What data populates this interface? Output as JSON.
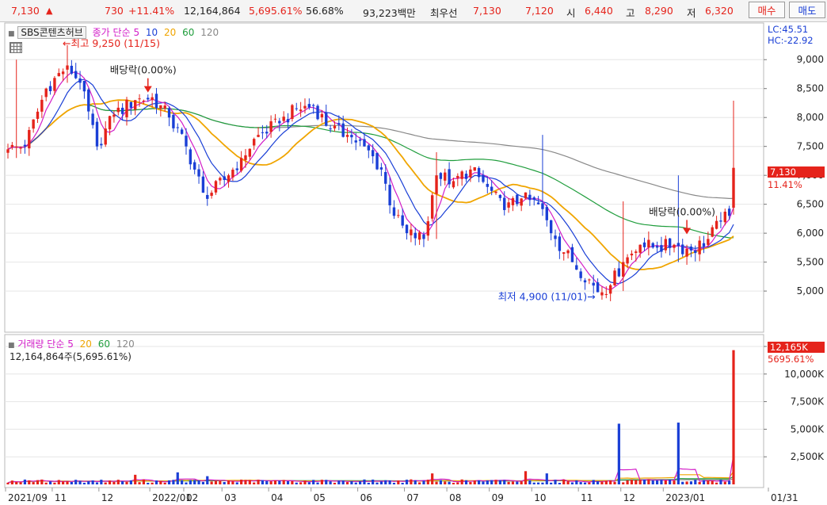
{
  "quote_bar": {
    "price": "7,130",
    "up_arrow": "▲",
    "change": "730",
    "change_pct": "+11.41%",
    "volume": "12,164,864",
    "volume_ratio": "5,695.61%",
    "turnover": "56.68%",
    "amount": "93,223백만",
    "best_ask_label": "최우선",
    "best_ask": "7,130",
    "best_bid": "7,120",
    "open_label": "시",
    "open": "6,440",
    "high_label": "고",
    "high": "8,290",
    "low_label": "저",
    "low": "6,320",
    "buy_label": "매수",
    "sell_label": "매도"
  },
  "price_panel": {
    "stock_name": "SBS콘텐츠허브",
    "legend_title": "종가 단순",
    "ma_periods": [
      "5",
      "10",
      "20",
      "60",
      "120"
    ],
    "lc": "LC:45.51",
    "hc": "HC:-22.92",
    "current_price_label": "7,130",
    "current_change_label": "11.41%"
  },
  "volume_panel": {
    "legend_title": "거래량 단순",
    "ma_periods": [
      "5",
      "20",
      "60",
      "120"
    ],
    "summary": "12,164,864주(5,695.61%)",
    "current_volume_label": "12,165K",
    "current_ratio_label": "5695.61%"
  },
  "chart_data": {
    "type": "candlestick",
    "x_tick_labels": [
      "2021/09",
      "11",
      "12",
      "2022/01",
      "02",
      "03",
      "04",
      "05",
      "06",
      "07",
      "08",
      "09",
      "10",
      "11",
      "12",
      "2023/01",
      "01/31"
    ],
    "price_axis": {
      "ylim": [
        4700,
        9250
      ],
      "ticks": [
        5000,
        5500,
        6000,
        6500,
        7000,
        7500,
        8000,
        8500,
        9000
      ]
    },
    "volume_axis": {
      "ylim": [
        0,
        12500
      ],
      "ticks": [
        2500,
        5000,
        7500,
        10000,
        12500
      ],
      "unit": "K"
    },
    "series_colors": {
      "up": "#e5231b",
      "down": "#1a3fd6",
      "ma5": "#d21dc8",
      "ma10": "#1a3fd6",
      "ma20": "#f0a500",
      "ma60": "#1f9d3c",
      "ma120": "#888888"
    },
    "close_anchors": [
      [
        0,
        7450
      ],
      [
        4,
        7500
      ],
      [
        9,
        8500
      ],
      [
        14,
        8900
      ],
      [
        17,
        8600
      ],
      [
        21,
        7500
      ],
      [
        25,
        8050
      ],
      [
        30,
        8300
      ],
      [
        34,
        8350
      ],
      [
        38,
        8000
      ],
      [
        42,
        7500
      ],
      [
        46,
        6700
      ],
      [
        48,
        6700
      ],
      [
        52,
        7000
      ],
      [
        55,
        7300
      ],
      [
        59,
        7700
      ],
      [
        64,
        7900
      ],
      [
        68,
        8150
      ],
      [
        72,
        8200
      ],
      [
        76,
        7800
      ],
      [
        80,
        7700
      ],
      [
        84,
        7500
      ],
      [
        88,
        7100
      ],
      [
        91,
        6300
      ],
      [
        94,
        6000
      ],
      [
        98,
        5900
      ],
      [
        101,
        7000
      ],
      [
        105,
        6900
      ],
      [
        109,
        7100
      ],
      [
        113,
        6800
      ],
      [
        117,
        6400
      ],
      [
        121,
        6600
      ],
      [
        125,
        6500
      ],
      [
        129,
        5900
      ],
      [
        133,
        5500
      ],
      [
        137,
        5200
      ],
      [
        139,
        4980
      ],
      [
        142,
        5100
      ],
      [
        145,
        5500
      ],
      [
        149,
        5800
      ],
      [
        153,
        5750
      ],
      [
        157,
        5800
      ],
      [
        161,
        5700
      ],
      [
        165,
        5900
      ],
      [
        168,
        6200
      ],
      [
        170,
        6300
      ],
      [
        171,
        7130
      ]
    ],
    "special_bars": [
      {
        "index": 2,
        "high": 9000,
        "low": 7300
      },
      {
        "index": 14,
        "high": 9250,
        "low": 8600
      },
      {
        "index": 101,
        "high": 7400,
        "low": 5900
      },
      {
        "index": 126,
        "high": 7700,
        "low": 6300
      },
      {
        "index": 145,
        "high": 6550,
        "low": 5000
      },
      {
        "index": 158,
        "high": 7000,
        "low": 5500
      },
      {
        "index": 171,
        "high": 8290,
        "low": 6320
      }
    ],
    "volume_spikes": [
      {
        "index": 144,
        "value": 5500
      },
      {
        "index": 158,
        "value": 5600
      },
      {
        "index": 171,
        "value": 12165
      }
    ],
    "volume_baseline": 350,
    "annotations": [
      {
        "text": "←최고 9,250 (11/15)",
        "index": 14,
        "price": 9250,
        "color": "#e5231b"
      },
      {
        "text": "최저 4,900 (11/01)→",
        "index": 139,
        "price": 4900,
        "color": "#1a3fd6"
      },
      {
        "text": "배당락(0.00%)",
        "index": 33,
        "price": 8350,
        "color": "#222222"
      },
      {
        "text": "배당락(0.00%)",
        "index": 160,
        "price": 5900,
        "color": "#222222"
      }
    ]
  }
}
